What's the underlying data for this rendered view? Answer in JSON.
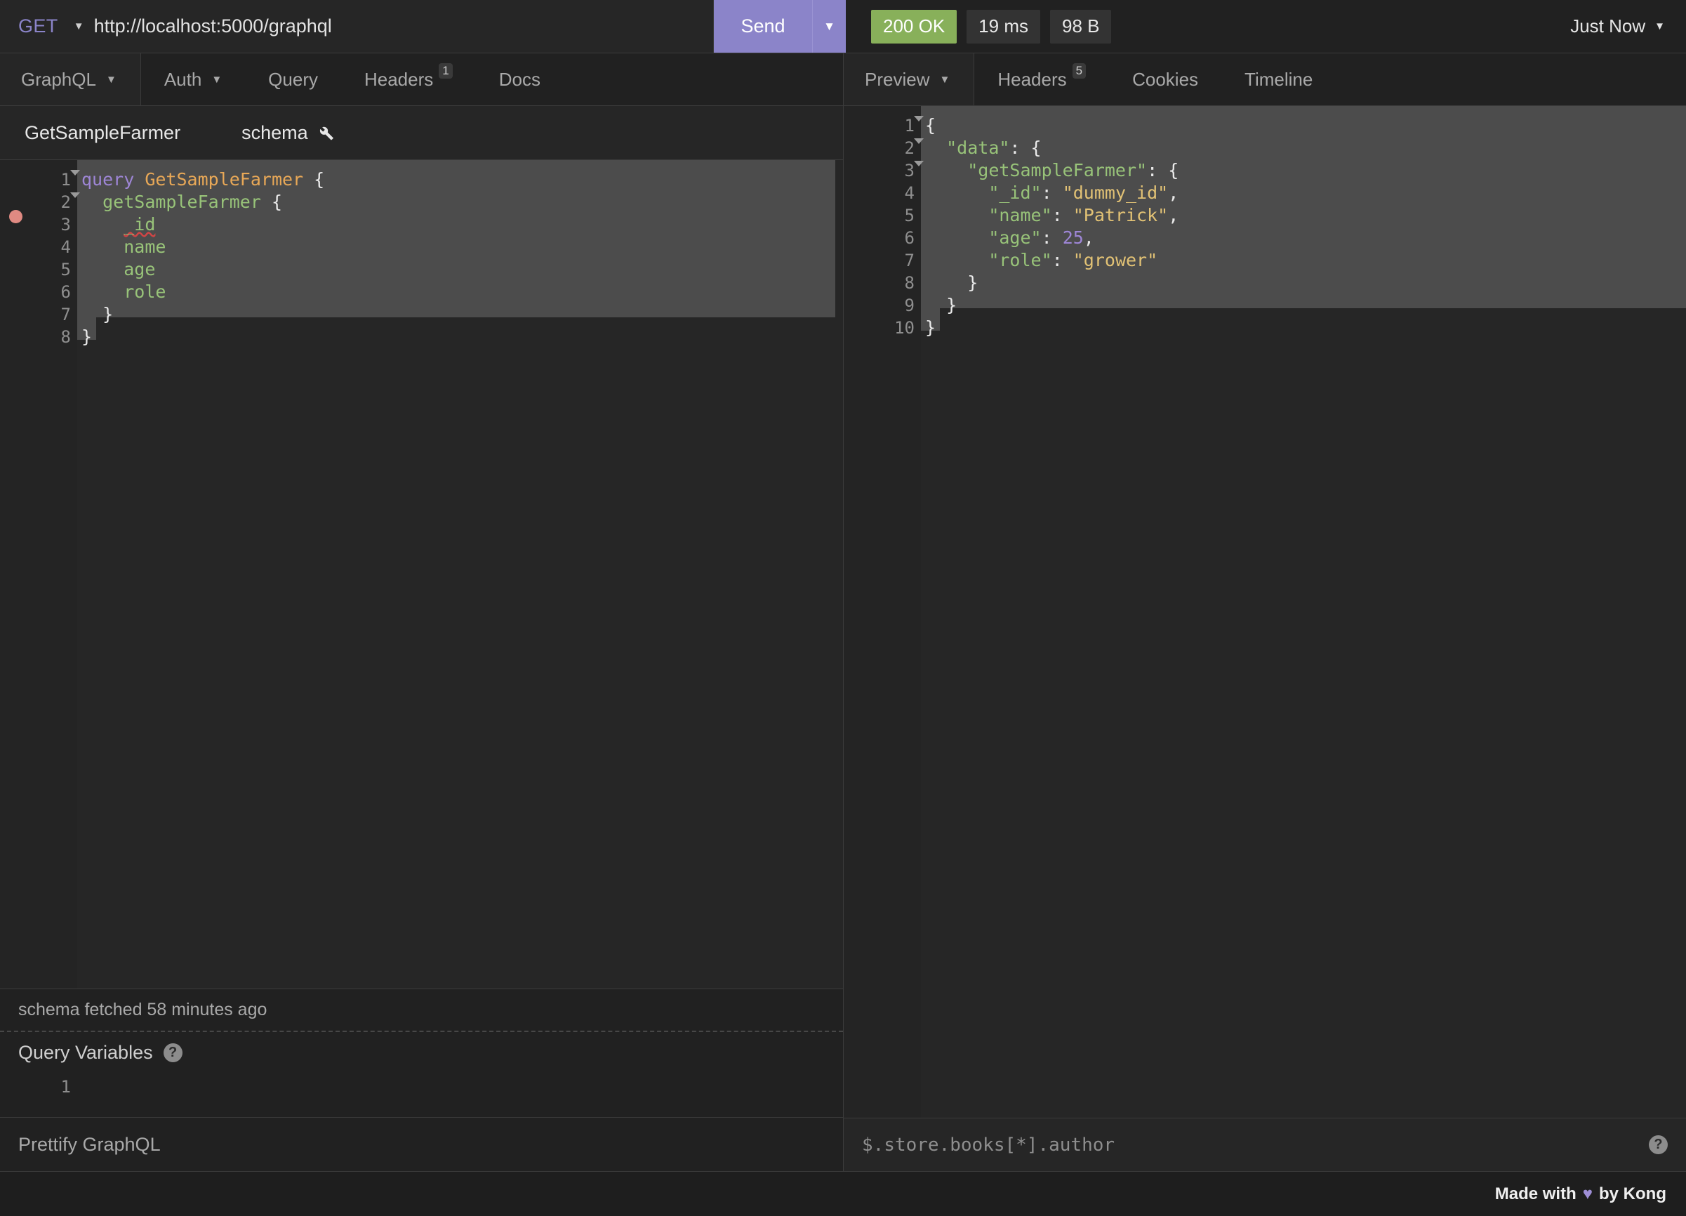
{
  "request_bar": {
    "method": "GET",
    "method_caret_icon": "chevron-down-icon",
    "url": "http://localhost:5000/graphql",
    "send_label": "Send",
    "send_caret_icon": "chevron-down-icon"
  },
  "status_bar": {
    "status": "200 OK",
    "status_color": "#88b05a",
    "time": "19 ms",
    "size": "98 B",
    "timestamp": "Just Now",
    "timestamp_caret_icon": "chevron-down-icon"
  },
  "request_tabs": [
    {
      "label": "GraphQL",
      "caret_icon": "chevron-down-icon",
      "active": true,
      "badge": null
    },
    {
      "label": "Auth",
      "caret_icon": "chevron-down-icon",
      "active": false,
      "badge": null
    },
    {
      "label": "Query",
      "caret_icon": null,
      "active": false,
      "badge": null
    },
    {
      "label": "Headers",
      "caret_icon": null,
      "active": false,
      "badge": "1"
    },
    {
      "label": "Docs",
      "caret_icon": null,
      "active": false,
      "badge": null
    }
  ],
  "response_tabs": [
    {
      "label": "Preview",
      "caret_icon": "chevron-down-icon",
      "active": true,
      "badge": null
    },
    {
      "label": "Headers",
      "caret_icon": null,
      "active": false,
      "badge": "5"
    },
    {
      "label": "Cookies",
      "caret_icon": null,
      "active": false,
      "badge": null
    },
    {
      "label": "Timeline",
      "caret_icon": null,
      "active": false,
      "badge": null
    }
  ],
  "operation_row": {
    "operation_name": "GetSampleFarmer",
    "schema_label": "schema",
    "schema_icon": "wrench-icon"
  },
  "query_editor": {
    "lines": [
      {
        "n": "1",
        "fold": true,
        "breakpoint": false,
        "selected": true,
        "tokens": [
          {
            "t": "query",
            "c": "kw"
          },
          {
            "t": " ",
            "c": "pun"
          },
          {
            "t": "GetSampleFarmer",
            "c": "opn"
          },
          {
            "t": " {",
            "c": "pun"
          }
        ]
      },
      {
        "n": "2",
        "fold": true,
        "breakpoint": false,
        "selected": true,
        "tokens": [
          {
            "t": "  ",
            "c": "pun"
          },
          {
            "t": "getSampleFarmer",
            "c": "fld"
          },
          {
            "t": " {",
            "c": "pun"
          }
        ]
      },
      {
        "n": "3",
        "fold": false,
        "breakpoint": true,
        "selected": true,
        "tokens": [
          {
            "t": "    ",
            "c": "pun"
          },
          {
            "t": "_id",
            "c": "fld squig"
          }
        ]
      },
      {
        "n": "4",
        "fold": false,
        "breakpoint": false,
        "selected": true,
        "tokens": [
          {
            "t": "    ",
            "c": "pun"
          },
          {
            "t": "name",
            "c": "fld"
          }
        ]
      },
      {
        "n": "5",
        "fold": false,
        "breakpoint": false,
        "selected": true,
        "tokens": [
          {
            "t": "    ",
            "c": "pun"
          },
          {
            "t": "age",
            "c": "fld"
          }
        ]
      },
      {
        "n": "6",
        "fold": false,
        "breakpoint": false,
        "selected": true,
        "tokens": [
          {
            "t": "    ",
            "c": "pun"
          },
          {
            "t": "role",
            "c": "fld"
          }
        ]
      },
      {
        "n": "7",
        "fold": false,
        "breakpoint": false,
        "selected": true,
        "tokens": [
          {
            "t": "  }",
            "c": "pun"
          }
        ]
      },
      {
        "n": "8",
        "fold": false,
        "breakpoint": false,
        "selected": "tail",
        "tokens": [
          {
            "t": "}",
            "c": "pun"
          }
        ]
      }
    ]
  },
  "response_editor": {
    "lines": [
      {
        "n": "1",
        "fold": true,
        "selected": true,
        "tokens": [
          {
            "t": "{",
            "c": "pun"
          }
        ]
      },
      {
        "n": "2",
        "fold": true,
        "selected": true,
        "tokens": [
          {
            "t": "  ",
            "c": "pun"
          },
          {
            "t": "\"data\"",
            "c": "key"
          },
          {
            "t": ": {",
            "c": "pun"
          }
        ]
      },
      {
        "n": "3",
        "fold": true,
        "selected": true,
        "tokens": [
          {
            "t": "    ",
            "c": "pun"
          },
          {
            "t": "\"getSampleFarmer\"",
            "c": "key"
          },
          {
            "t": ": {",
            "c": "pun"
          }
        ]
      },
      {
        "n": "4",
        "fold": false,
        "selected": true,
        "tokens": [
          {
            "t": "      ",
            "c": "pun"
          },
          {
            "t": "\"_id\"",
            "c": "key"
          },
          {
            "t": ": ",
            "c": "pun"
          },
          {
            "t": "\"dummy_id\"",
            "c": "str"
          },
          {
            "t": ",",
            "c": "pun"
          }
        ]
      },
      {
        "n": "5",
        "fold": false,
        "selected": true,
        "tokens": [
          {
            "t": "      ",
            "c": "pun"
          },
          {
            "t": "\"name\"",
            "c": "key"
          },
          {
            "t": ": ",
            "c": "pun"
          },
          {
            "t": "\"Patrick\"",
            "c": "str"
          },
          {
            "t": ",",
            "c": "pun"
          }
        ]
      },
      {
        "n": "6",
        "fold": false,
        "selected": true,
        "tokens": [
          {
            "t": "      ",
            "c": "pun"
          },
          {
            "t": "\"age\"",
            "c": "key"
          },
          {
            "t": ": ",
            "c": "pun"
          },
          {
            "t": "25",
            "c": "num"
          },
          {
            "t": ",",
            "c": "pun"
          }
        ]
      },
      {
        "n": "7",
        "fold": false,
        "selected": true,
        "tokens": [
          {
            "t": "      ",
            "c": "pun"
          },
          {
            "t": "\"role\"",
            "c": "key"
          },
          {
            "t": ": ",
            "c": "pun"
          },
          {
            "t": "\"grower\"",
            "c": "str"
          }
        ]
      },
      {
        "n": "8",
        "fold": false,
        "selected": true,
        "tokens": [
          {
            "t": "    }",
            "c": "pun"
          }
        ]
      },
      {
        "n": "9",
        "fold": false,
        "selected": true,
        "tokens": [
          {
            "t": "  }",
            "c": "pun"
          }
        ]
      },
      {
        "n": "10",
        "fold": false,
        "selected": "tail",
        "tokens": [
          {
            "t": "}",
            "c": "pun"
          }
        ]
      }
    ]
  },
  "schema_status": {
    "text": "schema fetched 58 minutes ago"
  },
  "query_variables": {
    "title": "Query Variables",
    "help_icon": "question-mark-icon",
    "help_glyph": "?",
    "line_number": "1",
    "value": ""
  },
  "prettify": {
    "label": "Prettify GraphQL"
  },
  "response_filter": {
    "placeholder": "$.store.books[*].author",
    "value": "",
    "help_icon": "question-mark-icon",
    "help_glyph": "?"
  },
  "footer": {
    "prefix": "Made with",
    "heart_icon": "heart-icon",
    "heart_glyph": "♥",
    "suffix": "by Kong",
    "heart_color": "#9e8ed6"
  }
}
